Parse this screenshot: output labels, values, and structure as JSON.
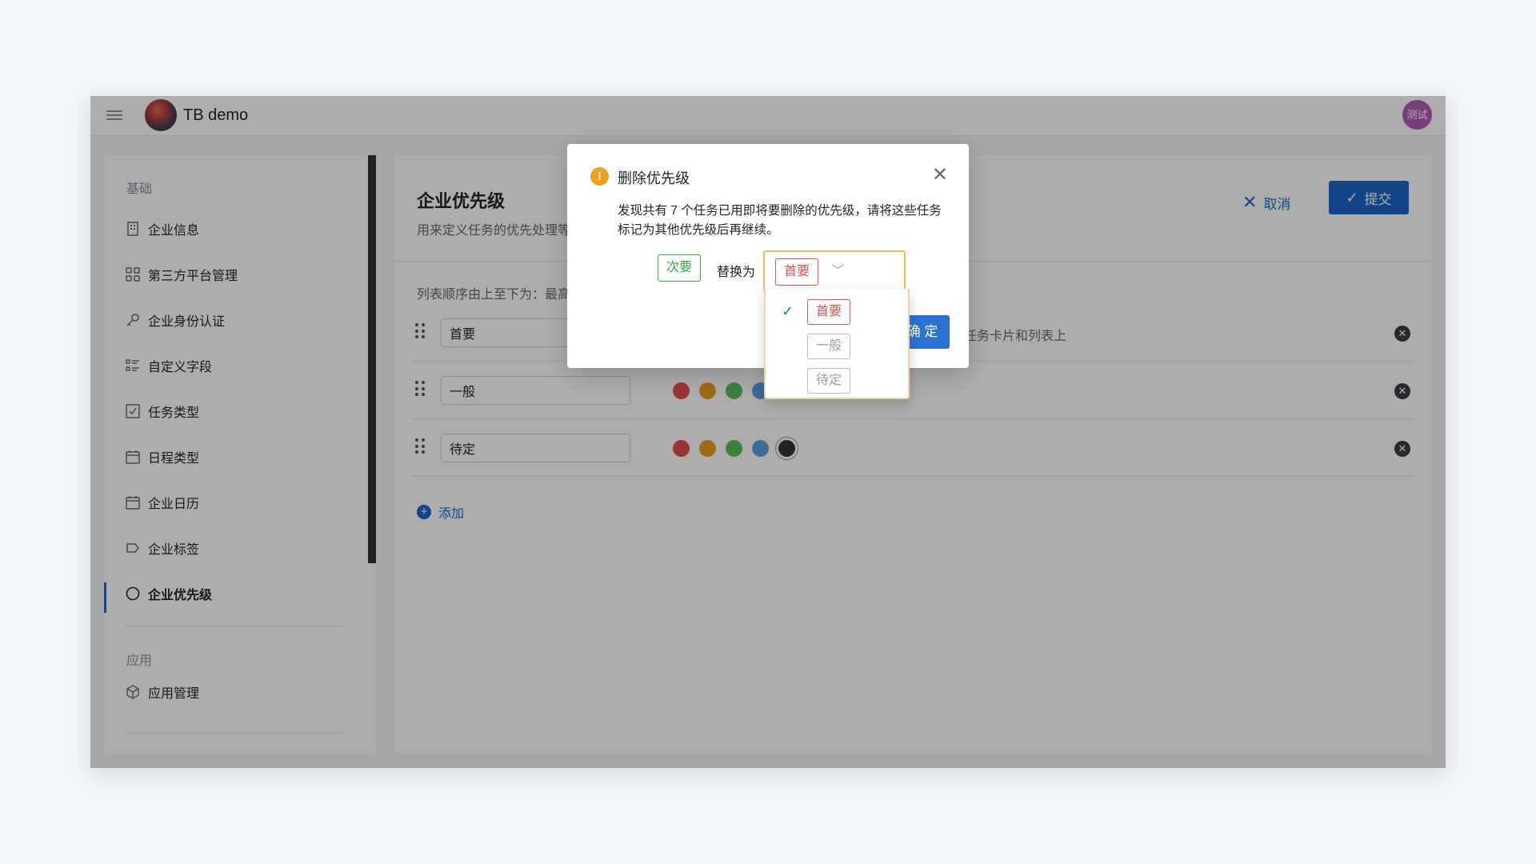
{
  "app": {
    "title": "TB demo",
    "user_avatar": "测试"
  },
  "sidebar": {
    "section_basic": "基础",
    "items": [
      {
        "label": "企业信息",
        "icon": "building-icon"
      },
      {
        "label": "第三方平台管理",
        "icon": "grid-icon"
      },
      {
        "label": "企业身份认证",
        "icon": "key-icon"
      },
      {
        "label": "自定义字段",
        "icon": "list-icon"
      },
      {
        "label": "任务类型",
        "icon": "checkbox-icon"
      },
      {
        "label": "日程类型",
        "icon": "calendar-icon"
      },
      {
        "label": "企业日历",
        "icon": "calendar-icon"
      },
      {
        "label": "企业标签",
        "icon": "tag-icon"
      },
      {
        "label": "企业优先级",
        "icon": "circle-icon",
        "active": true
      }
    ],
    "section_app": "应用",
    "app_items": [
      {
        "label": "应用管理",
        "icon": "cube-icon"
      }
    ]
  },
  "main": {
    "title": "企业优先级",
    "subtitle": "用来定义任务的优先处理等",
    "cancel_label": "取消",
    "submit_label": "提交",
    "list_hint": "列表顺序由上至下为：最高",
    "rows": [
      {
        "value": "首要",
        "desc": "任务卡片和列表上"
      },
      {
        "value": "一般",
        "desc": ""
      },
      {
        "value": "待定",
        "desc": ""
      }
    ],
    "colors": [
      "#e05050",
      "#e8a020",
      "#5cbf5c",
      "#5a9fe0",
      "#333333"
    ],
    "add_label": "添加"
  },
  "dialog": {
    "title": "删除优先级",
    "message": "发现共有 7 个任务已用即将要删除的优先级，请将这些任务标记为其他优先级后再继续。",
    "from_tag": "次要",
    "replace_label": "替换为",
    "selected": "首要",
    "ok_label": "确 定",
    "options": [
      {
        "label": "首要",
        "selected": true
      },
      {
        "label": "一般",
        "selected": false
      },
      {
        "label": "待定",
        "selected": false
      }
    ]
  }
}
